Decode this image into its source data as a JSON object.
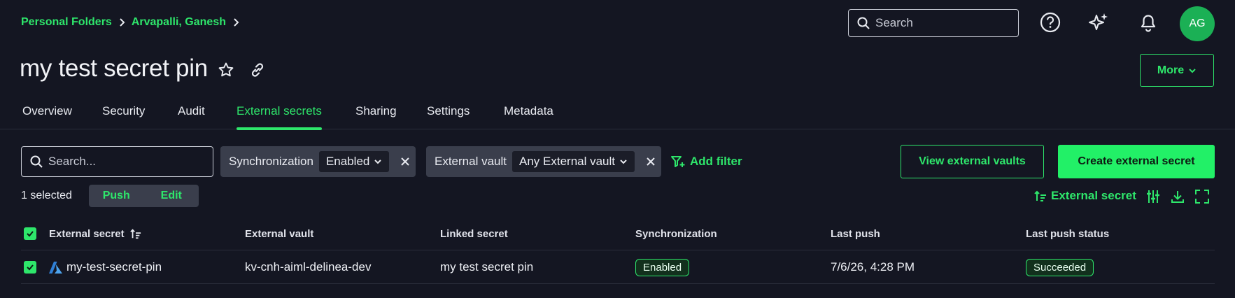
{
  "breadcrumb": {
    "items": [
      "Personal Folders",
      "Arvapalli, Ganesh"
    ]
  },
  "top_search": {
    "placeholder": "Search"
  },
  "user": {
    "initials": "AG"
  },
  "page": {
    "title": "my test secret pin",
    "more_label": "More"
  },
  "tabs": [
    {
      "label": "Overview",
      "active": false
    },
    {
      "label": "Security",
      "active": false
    },
    {
      "label": "Audit",
      "active": false
    },
    {
      "label": "External secrets",
      "active": true
    },
    {
      "label": "Sharing",
      "active": false
    },
    {
      "label": "Settings",
      "active": false
    },
    {
      "label": "Metadata",
      "active": false
    }
  ],
  "filters": {
    "search_placeholder": "Search...",
    "chips": [
      {
        "label": "Synchronization",
        "value": "Enabled"
      },
      {
        "label": "External vault",
        "value": "Any External vault"
      }
    ],
    "add_filter_label": "Add filter"
  },
  "actions": {
    "view_vaults": "View external vaults",
    "create": "Create external secret"
  },
  "selection": {
    "count_text": "1 selected",
    "push": "Push",
    "edit": "Edit"
  },
  "sort": {
    "label": "External secret"
  },
  "table": {
    "columns": [
      "External secret",
      "External vault",
      "Linked secret",
      "Synchronization",
      "Last push",
      "Last push status"
    ],
    "rows": [
      {
        "external_secret": "my-test-secret-pin",
        "external_vault": "kv-cnh-aiml-delinea-dev",
        "linked_secret": "my test secret pin",
        "synchronization": "Enabled",
        "last_push": "7/6/26, 4:28 PM",
        "last_push_status": "Succeeded"
      }
    ]
  },
  "colors": {
    "accent": "#2ee66b",
    "background": "#141622",
    "chip": "#3a3e4c"
  },
  "icons": [
    "chevron-right-icon",
    "search-icon",
    "help-icon",
    "sparkle-icon",
    "bell-icon",
    "star-icon",
    "link-icon",
    "chevron-down-icon",
    "close-icon",
    "filter-plus-icon",
    "sort-icon",
    "column-settings-icon",
    "download-icon",
    "fullscreen-icon",
    "check-icon",
    "azure-icon"
  ]
}
